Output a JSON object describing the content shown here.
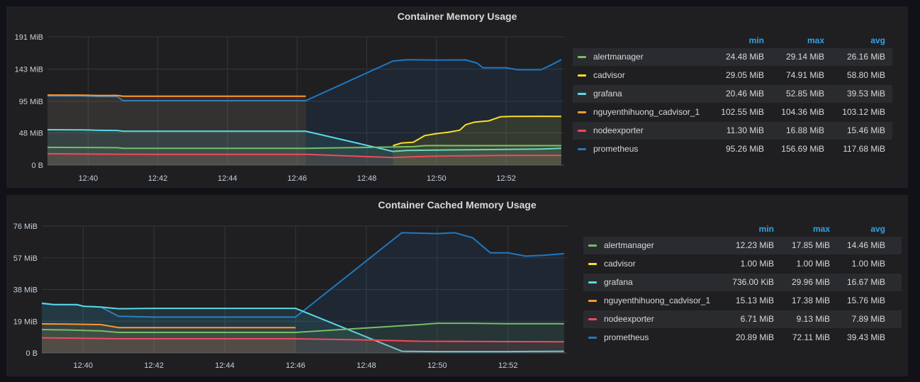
{
  "panels": [
    {
      "title": "Container Memory Usage",
      "legend_headers": {
        "min": "min",
        "max": "max",
        "avg": "avg"
      },
      "legend": [
        {
          "name": "alertmanager",
          "color": "#73bf69",
          "min": "24.48 MiB",
          "max": "29.14 MiB",
          "avg": "26.16 MiB"
        },
        {
          "name": "cadvisor",
          "color": "#fade2a",
          "min": "29.05 MiB",
          "max": "74.91 MiB",
          "avg": "58.80 MiB"
        },
        {
          "name": "grafana",
          "color": "#5ad8e6",
          "min": "20.46 MiB",
          "max": "52.85 MiB",
          "avg": "39.53 MiB"
        },
        {
          "name": "nguyenthihuong_cadvisor_1",
          "color": "#ff9830",
          "min": "102.55 MiB",
          "max": "104.36 MiB",
          "avg": "103.12 MiB"
        },
        {
          "name": "nodeexporter",
          "color": "#f2495c",
          "min": "11.30 MiB",
          "max": "16.88 MiB",
          "avg": "15.46 MiB"
        },
        {
          "name": "prometheus",
          "color": "#1f78c1",
          "min": "95.26 MiB",
          "max": "156.69 MiB",
          "avg": "117.68 MiB"
        }
      ]
    },
    {
      "title": "Container Cached Memory Usage",
      "legend_headers": {
        "min": "min",
        "max": "max",
        "avg": "avg"
      },
      "legend": [
        {
          "name": "alertmanager",
          "color": "#73bf69",
          "min": "12.23 MiB",
          "max": "17.85 MiB",
          "avg": "14.46 MiB"
        },
        {
          "name": "cadvisor",
          "color": "#fade2a",
          "min": "1.00 MiB",
          "max": "1.00 MiB",
          "avg": "1.00 MiB"
        },
        {
          "name": "grafana",
          "color": "#5ad8e6",
          "min": "736.00 KiB",
          "max": "29.96 MiB",
          "avg": "16.67 MiB"
        },
        {
          "name": "nguyenthihuong_cadvisor_1",
          "color": "#ff9830",
          "min": "15.13 MiB",
          "max": "17.38 MiB",
          "avg": "15.76 MiB"
        },
        {
          "name": "nodeexporter",
          "color": "#f2495c",
          "min": "6.71 MiB",
          "max": "9.13 MiB",
          "avg": "7.89 MiB"
        },
        {
          "name": "prometheus",
          "color": "#1f78c1",
          "min": "20.89 MiB",
          "max": "72.11 MiB",
          "avg": "39.43 MiB"
        }
      ]
    }
  ],
  "chart_data": [
    {
      "type": "area",
      "title": "Container Memory Usage",
      "x_unit": "minutes",
      "xlim": [
        "12:38:50",
        "12:53:40"
      ],
      "ylim": [
        0,
        191
      ],
      "y_ticks": [
        0,
        48,
        95,
        143,
        191
      ],
      "y_tick_labels": [
        "0 B",
        "48 MiB",
        "95 MiB",
        "143 MiB",
        "191 MiB"
      ],
      "x_ticks": [
        "12:40",
        "12:42",
        "12:44",
        "12:46",
        "12:48",
        "12:50",
        "12:52"
      ],
      "series": [
        {
          "name": "prometheus",
          "color": "#1f78c1",
          "points": [
            [
              "12:38:50",
              103
            ],
            [
              "12:39:20",
              103
            ],
            [
              "12:39:50",
              103
            ],
            [
              "12:40:20",
              102
            ],
            [
              "12:40:50",
              102
            ],
            [
              "12:41:00",
              96
            ],
            [
              "12:42:00",
              96
            ],
            [
              "12:43:00",
              96
            ],
            [
              "12:44:00",
              96
            ],
            [
              "12:45:00",
              96
            ],
            [
              "12:46:15",
              96
            ],
            [
              "12:48:45",
              155
            ],
            [
              "12:49:10",
              157
            ],
            [
              "12:50:00",
              156.5
            ],
            [
              "12:50:50",
              156.7
            ],
            [
              "12:51:10",
              152
            ],
            [
              "12:51:20",
              145
            ],
            [
              "12:52:00",
              145
            ],
            [
              "12:52:20",
              142
            ],
            [
              "12:53:00",
              142
            ],
            [
              "12:53:15",
              148
            ],
            [
              "12:53:35",
              157
            ]
          ]
        },
        {
          "name": "nguyenthihuong_cadvisor_1",
          "color": "#ff9830",
          "points": [
            [
              "12:38:50",
              104.4
            ],
            [
              "12:39:50",
              104.2
            ],
            [
              "12:40:20",
              103.6
            ],
            [
              "12:40:50",
              103.8
            ],
            [
              "12:41:00",
              102.6
            ],
            [
              "12:42:00",
              102.6
            ],
            [
              "12:43:00",
              102.6
            ],
            [
              "12:44:00",
              102.6
            ],
            [
              "12:45:00",
              102.6
            ],
            [
              "12:46:15",
              102.6
            ]
          ]
        },
        {
          "name": "grafana",
          "color": "#5ad8e6",
          "points": [
            [
              "12:38:50",
              52.8
            ],
            [
              "12:39:50",
              52.5
            ],
            [
              "12:40:20",
              51.8
            ],
            [
              "12:40:50",
              51.6
            ],
            [
              "12:41:00",
              50.5
            ],
            [
              "12:42:00",
              50.5
            ],
            [
              "12:44:00",
              50.5
            ],
            [
              "12:46:15",
              50.5
            ],
            [
              "12:48:45",
              20.5
            ],
            [
              "12:49:10",
              21.8
            ],
            [
              "12:50:00",
              22.5
            ],
            [
              "12:51:00",
              23
            ],
            [
              "12:52:00",
              23.5
            ],
            [
              "12:53:00",
              24
            ],
            [
              "12:53:35",
              25
            ]
          ]
        },
        {
          "name": "alertmanager",
          "color": "#73bf69",
          "points": [
            [
              "12:38:50",
              26.5
            ],
            [
              "12:39:50",
              26.3
            ],
            [
              "12:40:50",
              26
            ],
            [
              "12:41:00",
              25
            ],
            [
              "12:42:00",
              25
            ],
            [
              "12:44:00",
              25
            ],
            [
              "12:46:15",
              25
            ],
            [
              "12:48:45",
              27
            ],
            [
              "12:49:20",
              27.5
            ],
            [
              "12:49:40",
              29
            ],
            [
              "12:50:00",
              29.1
            ],
            [
              "12:51:00",
              29
            ],
            [
              "12:52:00",
              29
            ],
            [
              "12:53:35",
              29
            ]
          ]
        },
        {
          "name": "cadvisor",
          "color": "#fade2a",
          "points": [
            [
              "12:48:45",
              29
            ],
            [
              "12:49:00",
              33
            ],
            [
              "12:49:20",
              34
            ],
            [
              "12:49:40",
              44
            ],
            [
              "12:50:00",
              47
            ],
            [
              "12:50:20",
              49
            ],
            [
              "12:50:40",
              52
            ],
            [
              "12:50:50",
              60
            ],
            [
              "12:51:05",
              64
            ],
            [
              "12:51:30",
              66
            ],
            [
              "12:51:50",
              72
            ],
            [
              "12:52:10",
              72.5
            ],
            [
              "12:53:00",
              72.7
            ],
            [
              "12:53:35",
              72.5
            ]
          ]
        },
        {
          "name": "nodeexporter",
          "color": "#f2495c",
          "points": [
            [
              "12:38:50",
              17
            ],
            [
              "12:40:00",
              16.5
            ],
            [
              "12:41:00",
              16.2
            ],
            [
              "12:42:00",
              16
            ],
            [
              "12:44:00",
              16
            ],
            [
              "12:46:15",
              16
            ],
            [
              "12:48:45",
              11.3
            ],
            [
              "12:49:20",
              12.5
            ],
            [
              "12:50:00",
              13.5
            ],
            [
              "12:51:00",
              14
            ],
            [
              "12:52:00",
              14.5
            ],
            [
              "12:53:35",
              14.5
            ]
          ]
        }
      ]
    },
    {
      "type": "area",
      "title": "Container Cached Memory Usage",
      "x_unit": "minutes",
      "xlim": [
        "12:38:50",
        "12:53:40"
      ],
      "ylim": [
        0,
        76
      ],
      "y_ticks": [
        0,
        19,
        38,
        57,
        76
      ],
      "y_tick_labels": [
        "0 B",
        "19 MiB",
        "38 MiB",
        "57 MiB",
        "76 MiB"
      ],
      "x_ticks": [
        "12:40",
        "12:42",
        "12:44",
        "12:46",
        "12:48",
        "12:50",
        "12:52"
      ],
      "series": [
        {
          "name": "prometheus",
          "color": "#1f78c1",
          "points": [
            [
              "12:38:50",
              29.5
            ],
            [
              "12:39:10",
              29
            ],
            [
              "12:39:50",
              28.8
            ],
            [
              "12:40:00",
              28
            ],
            [
              "12:40:30",
              27.5
            ],
            [
              "12:41:00",
              22
            ],
            [
              "12:42:00",
              21.5
            ],
            [
              "12:43:00",
              21.5
            ],
            [
              "12:44:00",
              21.5
            ],
            [
              "12:45:00",
              21.5
            ],
            [
              "12:46:00",
              21.5
            ],
            [
              "12:49:00",
              72
            ],
            [
              "12:50:00",
              71.5
            ],
            [
              "12:50:30",
              72
            ],
            [
              "12:51:00",
              69
            ],
            [
              "12:51:30",
              60
            ],
            [
              "12:52:00",
              60
            ],
            [
              "12:52:30",
              58
            ],
            [
              "12:53:00",
              58.5
            ],
            [
              "12:53:35",
              59.5
            ]
          ]
        },
        {
          "name": "grafana",
          "color": "#5ad8e6",
          "points": [
            [
              "12:38:50",
              29.8
            ],
            [
              "12:39:10",
              29
            ],
            [
              "12:39:50",
              29
            ],
            [
              "12:40:00",
              28
            ],
            [
              "12:40:30",
              27.5
            ],
            [
              "12:41:00",
              26.5
            ],
            [
              "12:42:00",
              26.7
            ],
            [
              "12:43:00",
              26.7
            ],
            [
              "12:44:00",
              26.7
            ],
            [
              "12:45:00",
              26.7
            ],
            [
              "12:46:00",
              26.7
            ],
            [
              "12:49:00",
              1
            ],
            [
              "12:50:00",
              0.8
            ],
            [
              "12:51:00",
              0.8
            ],
            [
              "12:52:00",
              0.8
            ],
            [
              "12:53:35",
              1
            ]
          ]
        },
        {
          "name": "nguyenthihuong_cadvisor_1",
          "color": "#ff9830",
          "points": [
            [
              "12:38:50",
              17.4
            ],
            [
              "12:39:30",
              17.3
            ],
            [
              "12:40:30",
              17
            ],
            [
              "12:41:00",
              15.2
            ],
            [
              "12:42:00",
              15.2
            ],
            [
              "12:43:00",
              15.2
            ],
            [
              "12:44:00",
              15.2
            ],
            [
              "12:45:00",
              15.2
            ],
            [
              "12:46:00",
              15.2
            ]
          ]
        },
        {
          "name": "alertmanager",
          "color": "#73bf69",
          "points": [
            [
              "12:38:50",
              14
            ],
            [
              "12:39:30",
              13.8
            ],
            [
              "12:40:30",
              13.2
            ],
            [
              "12:41:00",
              12.3
            ],
            [
              "12:42:00",
              12.3
            ],
            [
              "12:44:00",
              12.3
            ],
            [
              "12:46:00",
              12.3
            ],
            [
              "12:48:00",
              15
            ],
            [
              "12:49:30",
              17
            ],
            [
              "12:50:00",
              17.8
            ],
            [
              "12:51:00",
              17.8
            ],
            [
              "12:52:00",
              17.5
            ],
            [
              "12:53:35",
              17.5
            ]
          ]
        },
        {
          "name": "nodeexporter",
          "color": "#f2495c",
          "points": [
            [
              "12:38:50",
              9.1
            ],
            [
              "12:40:00",
              8.8
            ],
            [
              "12:41:00",
              8.5
            ],
            [
              "12:42:00",
              8.5
            ],
            [
              "12:44:00",
              8.5
            ],
            [
              "12:46:00",
              8.5
            ],
            [
              "12:48:00",
              7.8
            ],
            [
              "12:49:30",
              7
            ],
            [
              "12:51:00",
              6.9
            ],
            [
              "12:52:00",
              6.8
            ],
            [
              "12:53:35",
              6.7
            ]
          ]
        },
        {
          "name": "cadvisor",
          "color": "#fade2a",
          "points": []
        }
      ]
    }
  ]
}
